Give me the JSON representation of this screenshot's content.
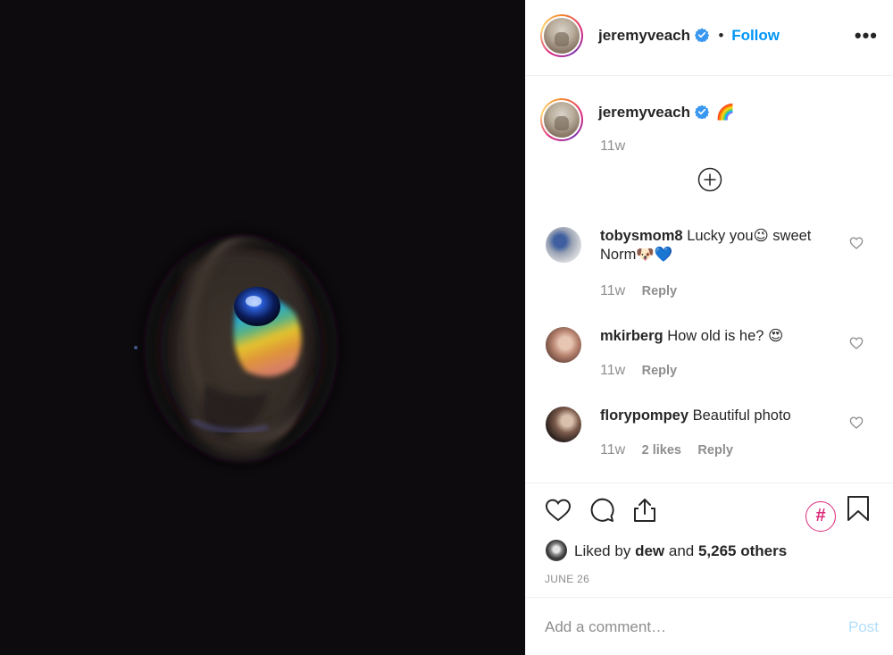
{
  "post": {
    "author": "jeremyveach",
    "follow_label": "Follow",
    "dot": "•",
    "more_label": "•••",
    "caption_emoji": "🌈",
    "caption_time": "11w"
  },
  "comments": [
    {
      "user": "tobysmom8",
      "text": "Lucky you😉 sweet Norm🐶💙",
      "time": "11w",
      "likes": "",
      "reply": "Reply"
    },
    {
      "user": "mkirberg",
      "text": "How old is he? 😍",
      "time": "11w",
      "likes": "",
      "reply": "Reply"
    },
    {
      "user": "florypompey",
      "text": "Beautiful photo",
      "time": "11w",
      "likes": "2 likes",
      "reply": "Reply"
    }
  ],
  "likes": {
    "prefix": "Liked by",
    "first_liker": "dew",
    "joiner": "and",
    "others": "5,265 others"
  },
  "date": "JUNE 26",
  "hashtag_badge": "#",
  "comment_box": {
    "placeholder": "Add a comment…",
    "post_label": "Post"
  },
  "colors": {
    "accent_blue": "#0095f6",
    "post_disabled": "#b2dffc",
    "media_bg": "#0e0b0f"
  }
}
